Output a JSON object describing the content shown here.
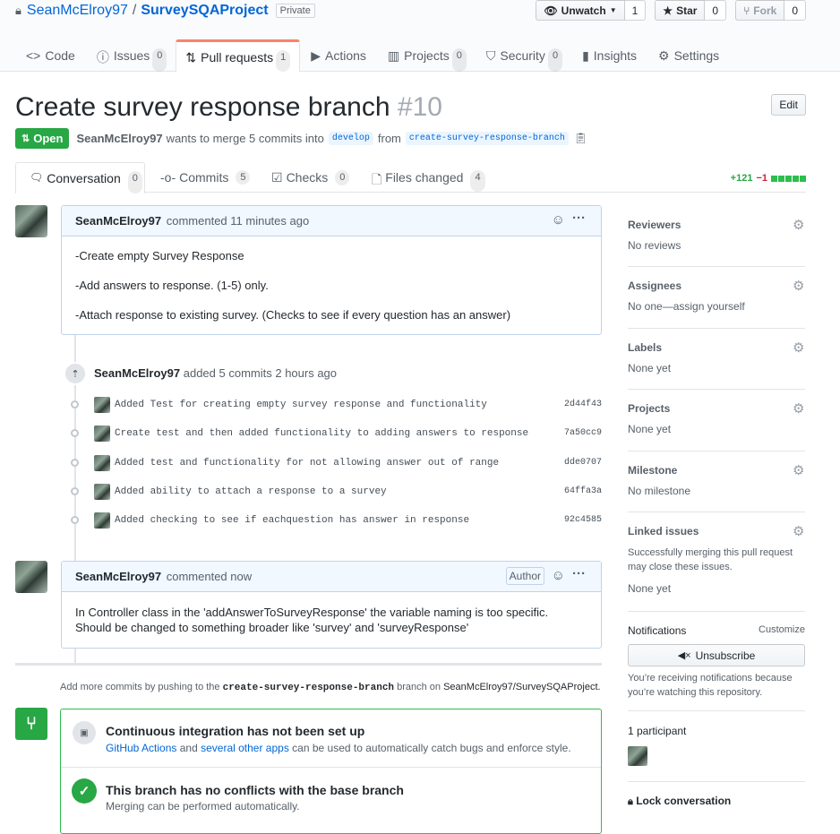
{
  "repo": {
    "owner": "SeanMcElroy97",
    "name": "SurveySQAProject",
    "visibility": "Private"
  },
  "actions": {
    "watch_label": "Unwatch",
    "watch_count": "1",
    "star_label": "Star",
    "star_count": "0",
    "fork_label": "Fork",
    "fork_count": "0"
  },
  "tabs": [
    {
      "label": "Code",
      "count": ""
    },
    {
      "label": "Issues",
      "count": "0"
    },
    {
      "label": "Pull requests",
      "count": "1"
    },
    {
      "label": "Actions",
      "count": ""
    },
    {
      "label": "Projects",
      "count": "0"
    },
    {
      "label": "Security",
      "count": "0"
    },
    {
      "label": "Insights",
      "count": ""
    },
    {
      "label": "Settings",
      "count": ""
    }
  ],
  "pr": {
    "title": "Create survey response branch",
    "number": "#10",
    "edit_label": "Edit",
    "state": "Open",
    "author": "SeanMcElroy97",
    "merge_text": "wants to merge 5 commits into",
    "base": "develop",
    "from_text": "from",
    "head": "create-survey-response-branch"
  },
  "pr_tabs": [
    {
      "label": "Conversation",
      "count": "0"
    },
    {
      "label": "Commits",
      "count": "5"
    },
    {
      "label": "Checks",
      "count": "0"
    },
    {
      "label": "Files changed",
      "count": "4"
    }
  ],
  "diffstat": {
    "added": "+121",
    "removed": "−1"
  },
  "comment1": {
    "author": "SeanMcElroy97",
    "meta": "commented 11 minutes ago",
    "lines": [
      "-Create empty Survey Response",
      "-Add answers to response. (1-5) only.",
      "-Attach response to existing survey. (Checks to see if every question has an answer)"
    ]
  },
  "commit_event": {
    "author": "SeanMcElroy97",
    "text": "added 5 commits",
    "time": "2 hours ago"
  },
  "commits": [
    {
      "message": "Added Test for creating empty survey response and functionality",
      "sha": "2d44f43"
    },
    {
      "message": "Create test and then added functionality to adding answers to response",
      "sha": "7a50cc9"
    },
    {
      "message": "Added test and functionality for not allowing answer out of range",
      "sha": "dde0707"
    },
    {
      "message": "Added ability to attach a response to a survey",
      "sha": "64ffa3a"
    },
    {
      "message": "Added checking to see if eachquestion has answer in response",
      "sha": "92c4585"
    }
  ],
  "comment2": {
    "author": "SeanMcElroy97",
    "meta": "commented now",
    "badge": "Author",
    "text": "In Controller class in the 'addAnswerToSurveyResponse' the variable naming is too specific. Should be changed to something broader like 'survey' and 'surveyResponse'"
  },
  "push_hint": {
    "pre": "Add more commits by pushing to the",
    "branch": "create-survey-response-branch",
    "mid": "branch on",
    "repo": "SeanMcElroy97/SurveySQAProject."
  },
  "merge_box": {
    "ci_title": "Continuous integration has not been set up",
    "ci_link1": "GitHub Actions",
    "ci_and": "and",
    "ci_link2": "several other apps",
    "ci_rest": "can be used to automatically catch bugs and enforce style.",
    "conflict_title": "This branch has no conflicts with the base branch",
    "conflict_sub": "Merging can be performed automatically."
  },
  "sidebar": {
    "reviewers": {
      "title": "Reviewers",
      "value": "No reviews"
    },
    "assignees": {
      "title": "Assignees",
      "value": "No one—assign yourself"
    },
    "labels": {
      "title": "Labels",
      "value": "None yet"
    },
    "projects": {
      "title": "Projects",
      "value": "None yet"
    },
    "milestone": {
      "title": "Milestone",
      "value": "No milestone"
    },
    "linked": {
      "title": "Linked issues",
      "desc": "Successfully merging this pull request may close these issues.",
      "value": "None yet"
    },
    "notifications": {
      "title": "Notifications",
      "customize": "Customize",
      "button": "Unsubscribe",
      "desc": "You’re receiving notifications because you’re watching this repository."
    },
    "participants": {
      "title": "1 participant"
    },
    "lock": {
      "label": "Lock conversation"
    }
  },
  "colors": {
    "accent": "#f9826c",
    "open_green": "#28a745",
    "link": "#0366d6",
    "box_blue": "#f1f8ff"
  }
}
